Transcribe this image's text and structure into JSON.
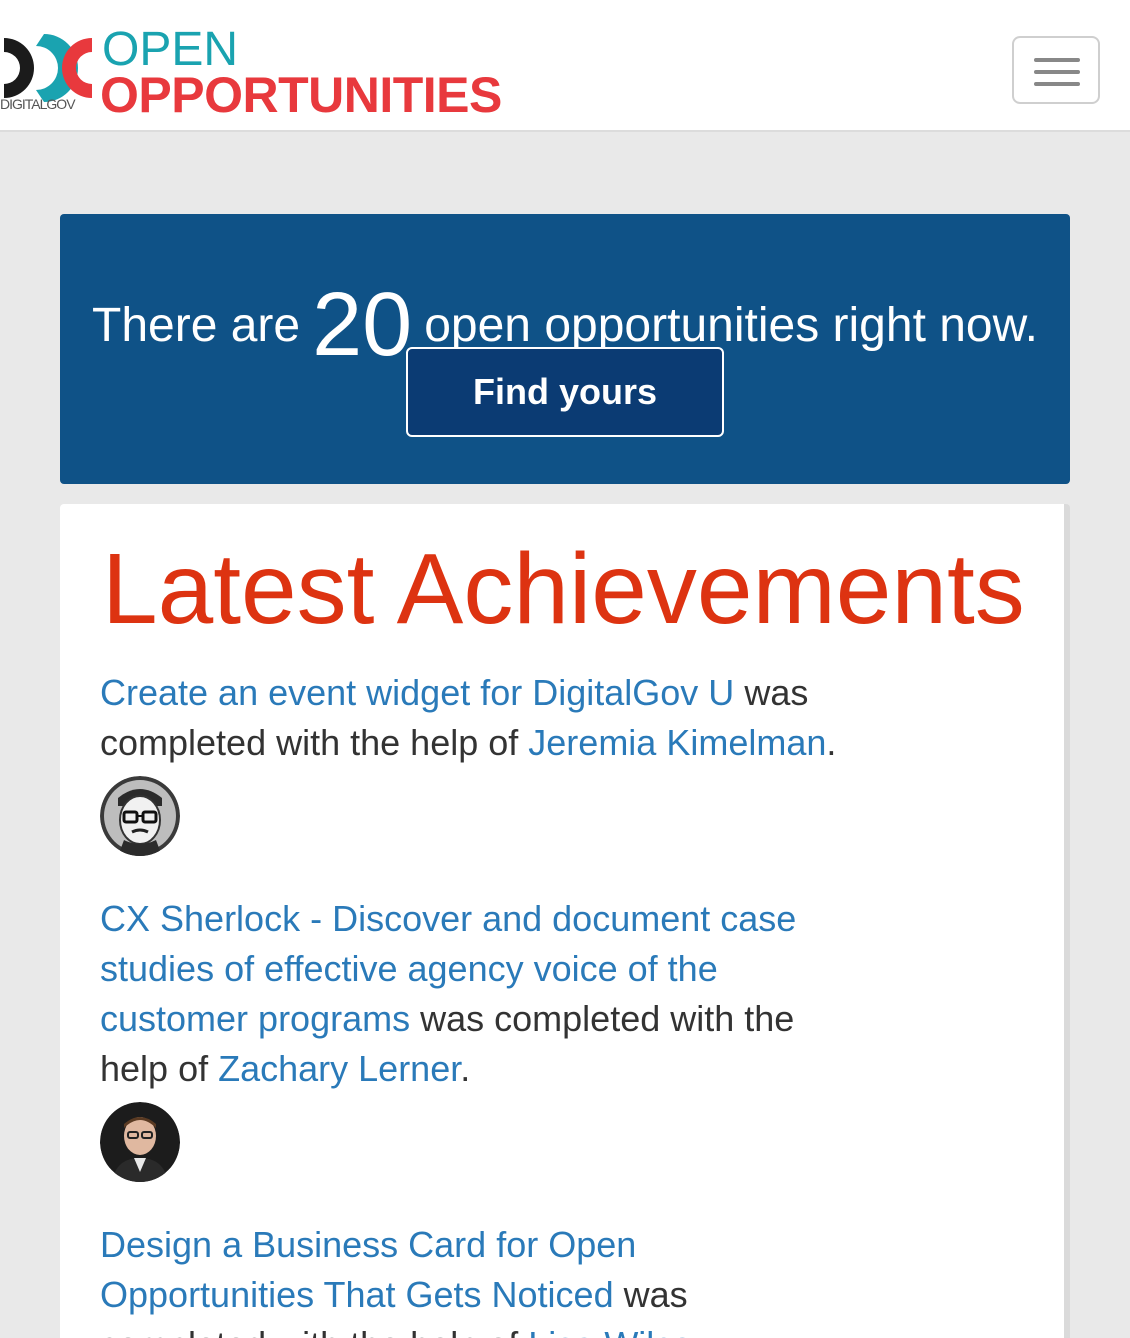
{
  "header": {
    "logo_top": "OPEN",
    "logo_bottom": "OPPORTUNITIES",
    "logo_sub": "DIGITALGOV"
  },
  "hero": {
    "prefix": "There are",
    "count": "20",
    "suffix": "open opportunities right now.",
    "button_label": "Find yours"
  },
  "achievements": {
    "title": "Latest Achievements",
    "items": [
      {
        "task": "Create an event widget for DigitalGov U",
        "text_mid": "was completed with the help of",
        "person": "Jeremia Kimelman",
        "text_end": "."
      },
      {
        "task": "CX Sherlock - Discover and document case studies of effective agency voice of the customer programs",
        "text_mid": "was completed with the help of",
        "person": "Zachary Lerner",
        "text_end": "."
      },
      {
        "task": "Design a Business Card for Open Opportunities That Gets Noticed",
        "text_mid": "was completed with the help of",
        "person": "Lisa Wilcox",
        "text_end": "."
      }
    ]
  },
  "colors": {
    "hero_bg": "#0f5287",
    "title_red": "#dd3311",
    "link_blue": "#2a7ab9",
    "logo_teal": "#1aa3b0",
    "logo_red": "#e8393d"
  }
}
